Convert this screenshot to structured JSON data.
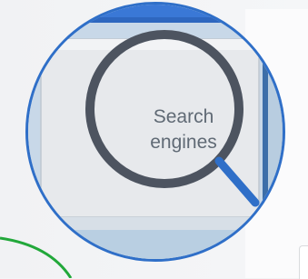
{
  "magnifier": {
    "label_line1": "Search",
    "label_line2": "engines"
  },
  "colors": {
    "lens_border": "#2f6fc8",
    "magnifier_ring": "#4d5460",
    "magnifier_handle": "#2f6fc8",
    "ui_blue_bar": "#3a78d6",
    "green_accent": "#22a83a"
  },
  "icons": [
    "magnifying-glass-icon"
  ]
}
